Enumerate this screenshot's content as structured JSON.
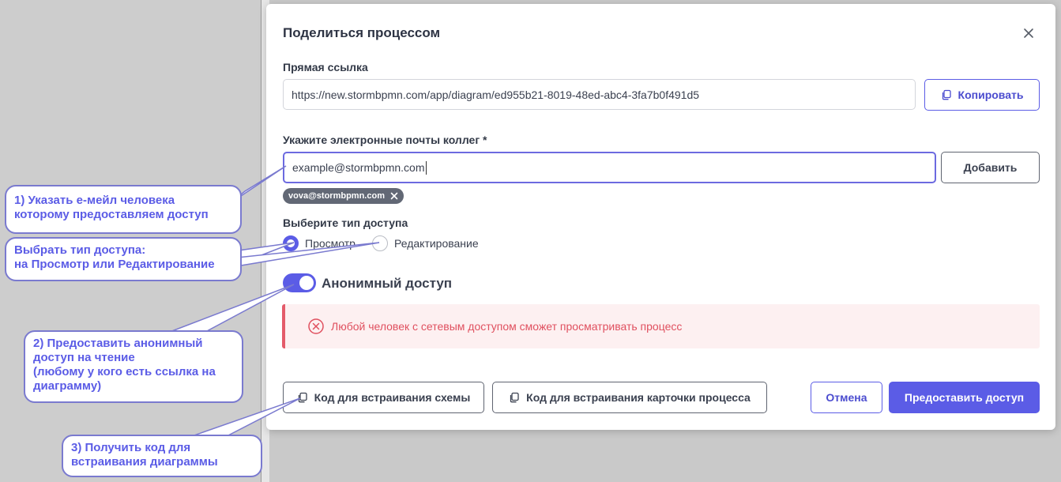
{
  "modal": {
    "title": "Поделиться процессом",
    "direct_link_label": "Прямая ссылка",
    "direct_link_value": "https://new.stormbpmn.com/app/diagram/ed955b21-8019-48ed-abc4-3fa7b0f491d5",
    "copy_label": "Копировать",
    "emails_label": "Укажите электронные почты коллег *",
    "email_value": "example@stormbpmn.com",
    "add_label": "Добавить",
    "chips": [
      "vova@stormbpmn.com"
    ],
    "access_type_label": "Выберите тип доступа",
    "access_options": [
      "Просмотр",
      "Редактирование"
    ],
    "access_selected": "Просмотр",
    "anonymous_label": "Анонимный доступ",
    "anonymous_enabled": true,
    "alert_text": "Любой человек с сетевым доступом сможет просматривать процесс",
    "embed_scheme_label": "Код для встраивания схемы",
    "embed_card_label": "Код для встраивания карточки процесса",
    "cancel_label": "Отмена",
    "grant_label": "Предоставить доступ"
  },
  "annotations": {
    "email_note": [
      "1) Указать е-мейл человека",
      "которому предоставляем доступ"
    ],
    "access_note": [
      "Выбрать тип доступа:",
      "на Просмотр или Редактирование"
    ],
    "anonymous_note": [
      "2) Предоставить анонимный",
      "доступ на чтение",
      "(любому у кого есть ссылка на",
      "диаграмму)"
    ],
    "embed_note": [
      "3) Получить код для",
      "встраивания диаграммы"
    ]
  },
  "colors": {
    "accent": "#5b5ce6",
    "alert_text": "#e0505f",
    "alert_bg": "#fdf0f1",
    "chip_bg": "#626875"
  },
  "icons": [
    "close-icon",
    "copy-icon",
    "chip-remove-icon",
    "error-circle-icon"
  ]
}
